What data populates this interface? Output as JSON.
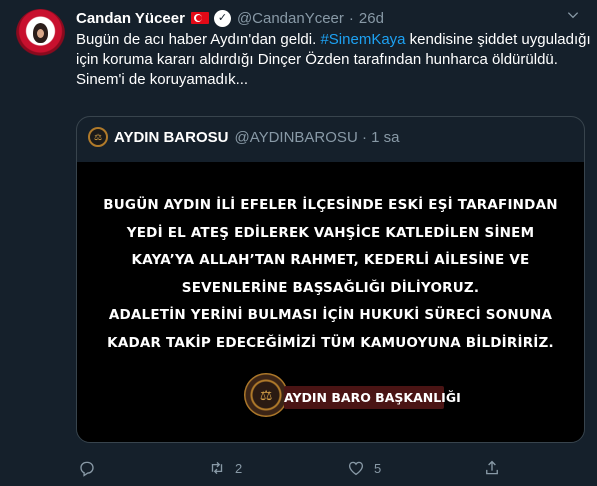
{
  "tweet": {
    "author": {
      "name": "Candan Yüceer",
      "handle": "@CandanYceer",
      "time": "26d"
    },
    "text": {
      "line1_pre": "Bugün de acı haber Aydın'dan geldi. ",
      "hashtag": "#SinemKaya",
      "line1_post": " kendisine şiddet uyguladığı",
      "line2": "için koruma kararı aldırdığı Dinçer Özden tarafından hunharca öldürüldü.",
      "line3": "Sinem'i de koruyamadık..."
    },
    "quote": {
      "name": "AYDIN BAROSU",
      "handle": "@AYDINBAROSU · 1 sa",
      "image_lines": [
        "BUGÜN AYDIN İLİ EFELER İLÇESİNDE ESKİ EŞİ TARAFINDAN",
        "YEDİ  EL ATEŞ EDİLEREK VAHŞİCE KATLEDİLEN SİNEM",
        "KAYA’YA ALLAH’TAN RAHMET, KEDERLİ AİLESİNE VE",
        "SEVENLERİNE BAŞSAĞLIĞI DİLİYORUZ.",
        "ADALETİN YERİNİ BULMASI İÇİN HUKUKİ SÜRECİ SONUNA",
        "KADAR TAKİP EDECEĞİMİZİ TÜM KAMUOYUNA BİLDİRİRİZ."
      ],
      "signature": "AYDIN BARO BAŞKANLIĞI"
    },
    "actions": {
      "reply_count": "",
      "retweet_count": "2",
      "like_count": "5"
    }
  },
  "colors": {
    "background": "#15202b",
    "border": "#38444d",
    "secondary_text": "#8899a6",
    "link": "#1da1f2",
    "banner": "#4a1414"
  },
  "icons": [
    "caret-down-icon",
    "verified-icon",
    "flag-icon",
    "reply-icon",
    "retweet-icon",
    "like-icon",
    "share-icon"
  ]
}
